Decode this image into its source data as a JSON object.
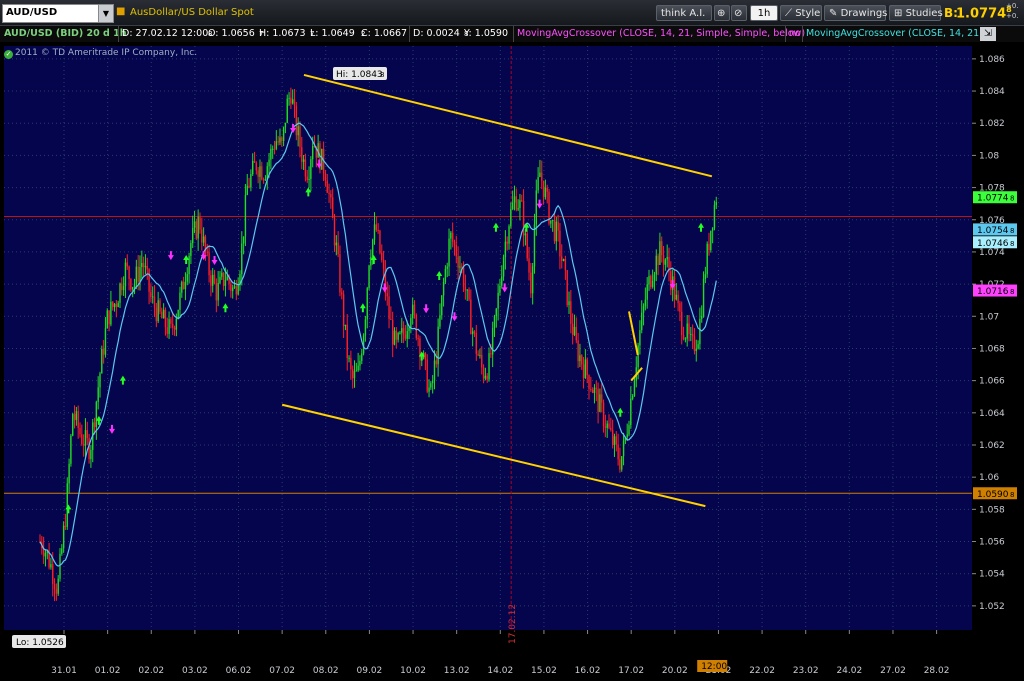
{
  "topbar": {
    "symbol": "AUD/USD",
    "description": "AusDollar/US Dollar Spot",
    "think_label": "think A.I.",
    "timeframe": "1h",
    "style_label": "Style",
    "drawings_label": "Drawings",
    "studies_label": "Studies",
    "bid_label": "B:",
    "bid_value": "1.0774",
    "bid_value_frac": "8",
    "change_line1": "+0.",
    "change_line2": "+0."
  },
  "infobar": {
    "title": "AUD/USD (BID) 20 d 1h",
    "date": "D: 27.02.12 12:00",
    "open": "O: 1.0656",
    "open_frac": "8",
    "high": "H: 1.0673",
    "high_frac": "7",
    "low": "L: 1.0649",
    "low_frac": "7",
    "close": "C: 1.0667",
    "close_frac": "2",
    "diff": "D: 0.0024",
    "y": "Y: 1.0590",
    "y_frac": "8",
    "study1": "MovingAvgCrossover (CLOSE, 14, 21, Simple, Simple, below)",
    "no": "no",
    "study2": "MovingAvgCrossover (CLOSE, 14, 21..."
  },
  "copyright": "2011 © TD Ameritrade IP Company, Inc.",
  "colors": {
    "background": "#05054e",
    "up": "#22dd22",
    "down": "#ff2020",
    "ma": "#5cc8f0",
    "trend": "#ffd200",
    "grid": "#2a3a6a",
    "hline": "#c01010",
    "yline": "#d08000",
    "vline": "#b00020",
    "signal_up": "#22ff22",
    "signal_down": "#ff30ff"
  },
  "chart_data": {
    "type": "candlestick",
    "symbol": "AUD/USD",
    "x_tick_labels": [
      "31.01",
      "01.02",
      "02.02",
      "03.02",
      "06.02",
      "07.02",
      "08.02",
      "09.02",
      "10.02",
      "13.02",
      "14.02",
      "15.02",
      "16.02",
      "17.02",
      "20.02",
      "21.02",
      "22.02",
      "23.02",
      "24.02",
      "27.02",
      "28.02"
    ],
    "y_tick_labels": [
      "1.052",
      "1.054",
      "1.056",
      "1.058",
      "1.06",
      "1.062",
      "1.064",
      "1.066",
      "1.068",
      "1.07",
      "1.072",
      "1.074",
      "1.076",
      "1.078",
      "1.08",
      "1.082",
      "1.084",
      "1.086"
    ],
    "ylim": [
      1.0505,
      1.0868
    ],
    "price_path": [
      {
        "day": -0.5,
        "price": 1.056
      },
      {
        "day": -0.3,
        "price": 1.0545
      },
      {
        "day": -0.15,
        "price": 1.053
      },
      {
        "day": 0.05,
        "price": 1.058
      },
      {
        "day": 0.2,
        "price": 1.064
      },
      {
        "day": 0.4,
        "price": 1.0625
      },
      {
        "day": 0.6,
        "price": 1.0618
      },
      {
        "day": 0.8,
        "price": 1.066
      },
      {
        "day": 1.0,
        "price": 1.07
      },
      {
        "day": 1.2,
        "price": 1.071
      },
      {
        "day": 1.4,
        "price": 1.073
      },
      {
        "day": 1.6,
        "price": 1.072
      },
      {
        "day": 1.8,
        "price": 1.0735
      },
      {
        "day": 2.0,
        "price": 1.071
      },
      {
        "day": 2.2,
        "price": 1.07
      },
      {
        "day": 2.45,
        "price": 1.069
      },
      {
        "day": 2.7,
        "price": 1.0715
      },
      {
        "day": 2.9,
        "price": 1.0745
      },
      {
        "day": 3.1,
        "price": 1.076
      },
      {
        "day": 3.3,
        "price": 1.073
      },
      {
        "day": 3.5,
        "price": 1.0715
      },
      {
        "day": 3.7,
        "price": 1.0725
      },
      {
        "day": 3.9,
        "price": 1.0715
      },
      {
        "day": 4.05,
        "price": 1.0735
      },
      {
        "day": 4.2,
        "price": 1.078
      },
      {
        "day": 4.4,
        "price": 1.0795
      },
      {
        "day": 4.6,
        "price": 1.079
      },
      {
        "day": 4.85,
        "price": 1.081
      },
      {
        "day": 5.0,
        "price": 1.0805
      },
      {
        "day": 5.1,
        "price": 1.083
      },
      {
        "day": 5.2,
        "price": 1.084
      },
      {
        "day": 5.3,
        "price": 1.082
      },
      {
        "day": 5.5,
        "price": 1.0795
      },
      {
        "day": 5.6,
        "price": 1.079
      },
      {
        "day": 5.7,
        "price": 1.081
      },
      {
        "day": 5.85,
        "price": 1.08
      },
      {
        "day": 6.0,
        "price": 1.079
      },
      {
        "day": 6.1,
        "price": 1.077
      },
      {
        "day": 6.25,
        "price": 1.074
      },
      {
        "day": 6.4,
        "price": 1.07
      },
      {
        "day": 6.5,
        "price": 1.0675
      },
      {
        "day": 6.6,
        "price": 1.066
      },
      {
        "day": 6.75,
        "price": 1.0665
      },
      {
        "day": 6.9,
        "price": 1.07
      },
      {
        "day": 7.0,
        "price": 1.074
      },
      {
        "day": 7.15,
        "price": 1.0755
      },
      {
        "day": 7.3,
        "price": 1.073
      },
      {
        "day": 7.45,
        "price": 1.07
      },
      {
        "day": 7.6,
        "price": 1.068
      },
      {
        "day": 7.8,
        "price": 1.069
      },
      {
        "day": 7.95,
        "price": 1.0705
      },
      {
        "day": 8.1,
        "price": 1.069
      },
      {
        "day": 8.25,
        "price": 1.067
      },
      {
        "day": 8.4,
        "price": 1.065
      },
      {
        "day": 8.55,
        "price": 1.068
      },
      {
        "day": 8.7,
        "price": 1.072
      },
      {
        "day": 8.85,
        "price": 1.075
      },
      {
        "day": 9.0,
        "price": 1.074
      },
      {
        "day": 9.15,
        "price": 1.0725
      },
      {
        "day": 9.3,
        "price": 1.07
      },
      {
        "day": 9.45,
        "price": 1.068
      },
      {
        "day": 9.6,
        "price": 1.0665
      },
      {
        "day": 9.75,
        "price": 1.067
      },
      {
        "day": 9.9,
        "price": 1.07
      },
      {
        "day": 10.05,
        "price": 1.0735
      },
      {
        "day": 10.2,
        "price": 1.076
      },
      {
        "day": 10.35,
        "price": 1.0775
      },
      {
        "day": 10.5,
        "price": 1.0765
      },
      {
        "day": 10.6,
        "price": 1.074
      },
      {
        "day": 10.7,
        "price": 1.072
      },
      {
        "day": 10.8,
        "price": 1.0765
      },
      {
        "day": 10.9,
        "price": 1.079
      },
      {
        "day": 11.0,
        "price": 1.078
      },
      {
        "day": 11.15,
        "price": 1.076
      },
      {
        "day": 11.3,
        "price": 1.075
      },
      {
        "day": 11.45,
        "price": 1.073
      },
      {
        "day": 11.6,
        "price": 1.07
      },
      {
        "day": 11.75,
        "price": 1.068
      },
      {
        "day": 11.9,
        "price": 1.067
      },
      {
        "day": 12.05,
        "price": 1.066
      },
      {
        "day": 12.2,
        "price": 1.065
      },
      {
        "day": 12.4,
        "price": 1.0635
      },
      {
        "day": 12.6,
        "price": 1.062
      },
      {
        "day": 12.75,
        "price": 1.061
      },
      {
        "day": 12.85,
        "price": 1.062
      },
      {
        "day": 13.0,
        "price": 1.065
      },
      {
        "day": 13.2,
        "price": 1.069
      },
      {
        "day": 13.35,
        "price": 1.0715
      },
      {
        "day": 13.5,
        "price": 1.073
      },
      {
        "day": 13.65,
        "price": 1.074
      },
      {
        "day": 13.8,
        "price": 1.0735
      },
      {
        "day": 13.95,
        "price": 1.072
      },
      {
        "day": 14.1,
        "price": 1.07
      },
      {
        "day": 14.25,
        "price": 1.069
      },
      {
        "day": 14.4,
        "price": 1.068
      },
      {
        "day": 14.55,
        "price": 1.069
      },
      {
        "day": 14.7,
        "price": 1.073
      },
      {
        "day": 14.85,
        "price": 1.076
      },
      {
        "day": 14.95,
        "price": 1.0775
      }
    ],
    "annotations": {
      "high": "Hi: 1.0843",
      "high_frac": "8",
      "low": "Lo: 1.0526",
      "y_line_label": "1.0590",
      "y_line_frac": "8",
      "vline_date": "17.02.12",
      "cursor_time": "12:00"
    },
    "price_tags": [
      {
        "value": "1.0774",
        "frac": "8",
        "type": "last",
        "price": 1.0774
      },
      {
        "value": "1.0754",
        "frac": "8",
        "type": "ma",
        "price": 1.0754
      },
      {
        "value": "1.0746",
        "frac": "8",
        "type": "ma2",
        "price": 1.0746
      },
      {
        "value": "1.0716",
        "frac": "8",
        "type": "down",
        "price": 1.0716
      },
      {
        "value": "1.0590",
        "frac": "8",
        "type": "yline",
        "price": 1.059
      }
    ],
    "h_lines": [
      {
        "price": 1.0762,
        "kind": "red"
      },
      {
        "price": 1.059,
        "kind": "orange"
      }
    ],
    "vline_day": 10.25,
    "trendlines": [
      {
        "from": {
          "day": 5.5,
          "price": 1.085
        },
        "to": {
          "day": 14.85,
          "price": 1.0787
        }
      },
      {
        "from": {
          "day": 5.0,
          "price": 1.0645
        },
        "to": {
          "day": 14.7,
          "price": 1.0582
        }
      },
      {
        "from": {
          "day": 12.95,
          "price": 1.0703
        },
        "to": {
          "day": 13.15,
          "price": 1.0676
        }
      },
      {
        "from": {
          "day": 13.0,
          "price": 1.066
        },
        "to": {
          "day": 13.25,
          "price": 1.0668
        }
      }
    ],
    "signals": {
      "up": [
        {
          "day": 0.1,
          "price": 1.058
        },
        {
          "day": 0.8,
          "price": 1.0635
        },
        {
          "day": 1.35,
          "price": 1.066
        },
        {
          "day": 2.8,
          "price": 1.0735
        },
        {
          "day": 3.7,
          "price": 1.0705
        },
        {
          "day": 5.6,
          "price": 1.0777
        },
        {
          "day": 6.85,
          "price": 1.0705
        },
        {
          "day": 7.1,
          "price": 1.0735
        },
        {
          "day": 8.2,
          "price": 1.0675
        },
        {
          "day": 8.6,
          "price": 1.0725
        },
        {
          "day": 9.9,
          "price": 1.0755
        },
        {
          "day": 10.6,
          "price": 1.0755
        },
        {
          "day": 12.75,
          "price": 1.064
        },
        {
          "day": 14.6,
          "price": 1.0755
        }
      ],
      "down": [
        {
          "day": 1.1,
          "price": 1.063
        },
        {
          "day": 2.45,
          "price": 1.0738
        },
        {
          "day": 3.2,
          "price": 1.0738
        },
        {
          "day": 3.45,
          "price": 1.0735
        },
        {
          "day": 5.25,
          "price": 1.0817
        },
        {
          "day": 5.85,
          "price": 1.0795
        },
        {
          "day": 7.35,
          "price": 1.0718
        },
        {
          "day": 8.3,
          "price": 1.0705
        },
        {
          "day": 8.95,
          "price": 1.07
        },
        {
          "day": 10.1,
          "price": 1.0718
        },
        {
          "day": 10.9,
          "price": 1.077
        },
        {
          "day": 13.95,
          "price": 1.072
        }
      ]
    }
  }
}
